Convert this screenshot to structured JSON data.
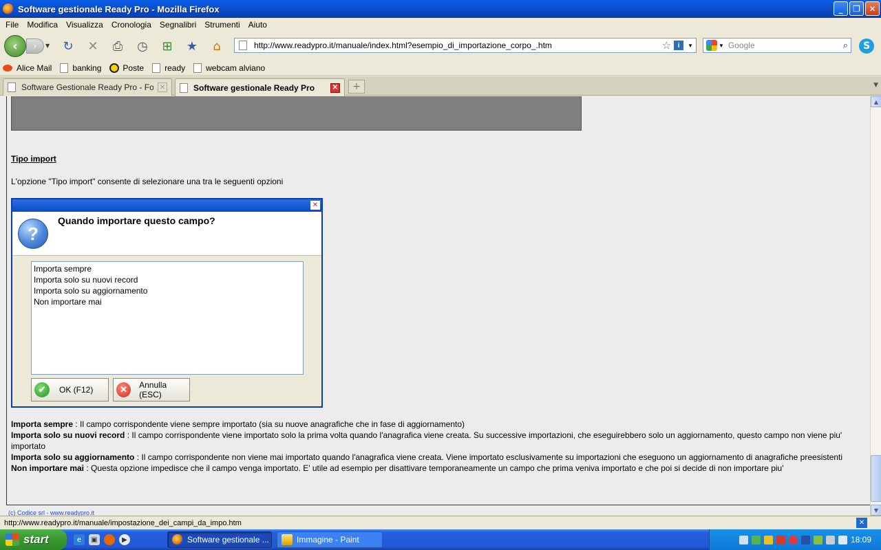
{
  "window": {
    "title": "Software gestionale Ready Pro - Mozilla Firefox",
    "minimize": "_",
    "maximize": "❐",
    "close": "✕"
  },
  "menu": [
    "File",
    "Modifica",
    "Visualizza",
    "Cronologia",
    "Segnalibri",
    "Strumenti",
    "Aiuto"
  ],
  "nav": {
    "url": "http://www.readypro.it/manuale/index.html?esempio_di_importazione_corpo_.htm",
    "search_placeholder": "Google"
  },
  "bookmarks": [
    "Alice Mail",
    "banking",
    "Poste",
    "ready",
    "webcam alviano"
  ],
  "tabs": [
    {
      "label": "Software Gestionale Ready Pro - Foru..."
    },
    {
      "label": "Software gestionale Ready Pro"
    }
  ],
  "content": {
    "heading": "Tipo import",
    "intro": "L'opzione \"Tipo import\" consente di selezionare una tra le seguenti opzioni",
    "dialog": {
      "question": "Quando importare questo campo?",
      "options": [
        "Importa sempre",
        "Importa solo su nuovi record",
        "Importa solo su aggiornamento",
        "Non importare mai"
      ],
      "ok_label": "OK (F12)",
      "cancel_label": "Annulla (ESC)"
    },
    "descriptions": [
      {
        "term": "Importa sempre",
        "text": " : Il campo corrispondente viene sempre importato (sia su nuove anagrafiche che in fase di aggiornamento)"
      },
      {
        "term": "Importa solo su nuovi record",
        "text": " : Il campo corrispondente viene importato solo la prima volta quando l'anagrafica viene creata. Su successive importazioni, che eseguirebbero solo un aggiornamento, questo campo non viene piu' importato"
      },
      {
        "term": "Importa solo su aggiornamento",
        "text": " : Il campo corrispondente non viene mai importato quando l'anagrafica viene creata. Viene importato esclusivamente su importazioni che eseguono un aggiornamento di anagrafiche preesistenti"
      },
      {
        "term": "Non importare mai",
        "text": " : Questa opzione impedisce che il campo venga importato. E' utile ad esempio per disattivare temporaneamente un campo che prima veniva importato e che poi si decide di non importare piu'"
      }
    ],
    "copyright": "(c) Codice srl - www.readypro.it"
  },
  "status": {
    "text": "http://www.readypro.it/manuale/impostazione_dei_campi_da_impo.htm"
  },
  "taskbar": {
    "start": "start",
    "tasks": [
      "Software gestionale ...",
      "Immagine - Paint"
    ],
    "clock": "18:09"
  }
}
